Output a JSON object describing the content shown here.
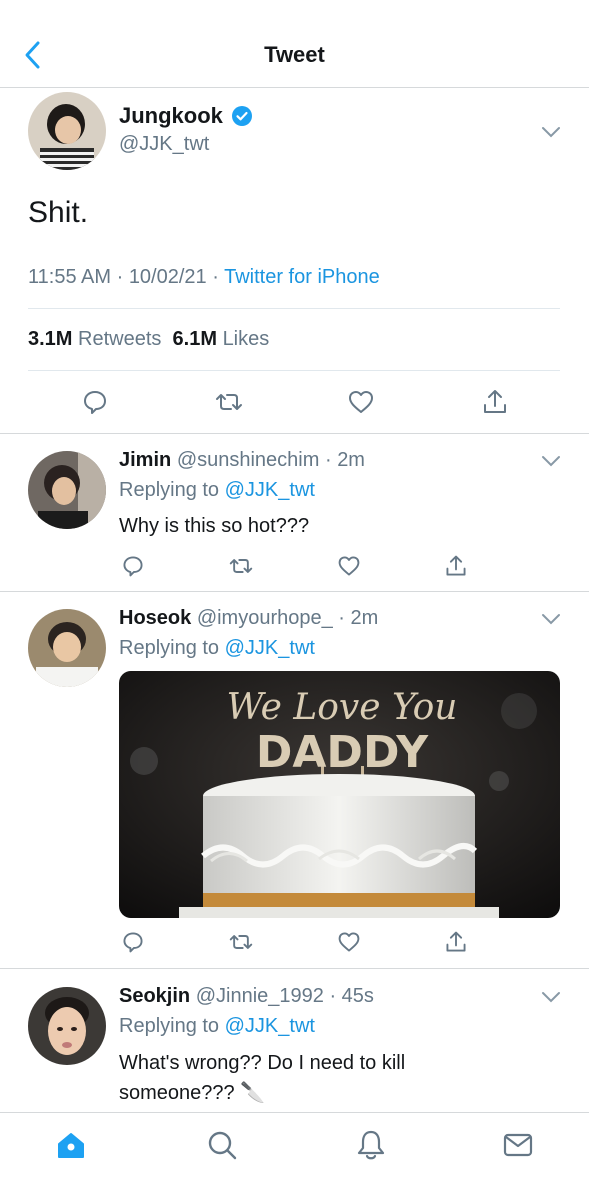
{
  "header": {
    "title": "Tweet",
    "back_icon": "chevron-left-icon"
  },
  "main_tweet": {
    "name": "Jungkook",
    "handle": "@JJK_twt",
    "verified": true,
    "text": "Shit.",
    "time": "11:55 AM",
    "date": "10/02/21",
    "source": "Twitter for iPhone",
    "retweets_count": "3.1M",
    "retweets_label": "Retweets",
    "likes_count": "6.1M",
    "likes_label": "Likes"
  },
  "replies": [
    {
      "name": "Jimin",
      "handle": "@sunshinechim",
      "time": "2m",
      "replying_prefix": "Replying to",
      "replying_to": "@JJK_twt",
      "text": "Why is this so hot???"
    },
    {
      "name": "Hoseok",
      "handle": "@imyourhope_",
      "time": "2m",
      "replying_prefix": "Replying to",
      "replying_to": "@JJK_twt",
      "image_text_line1": "We Love You",
      "image_text_line2": "DADDY"
    },
    {
      "name": "Seokjin",
      "handle": "@Jinnie_1992",
      "time": "45s",
      "replying_prefix": "Replying to",
      "replying_to": "@JJK_twt",
      "text": "What's wrong?? Do I need to kill someone??? 🔪"
    }
  ],
  "tabs": [
    "home-icon",
    "search-icon",
    "notifications-icon",
    "messages-icon"
  ],
  "colors": {
    "accent": "#1da1f2",
    "link": "#1b95e0",
    "secondary_text": "#657786"
  }
}
